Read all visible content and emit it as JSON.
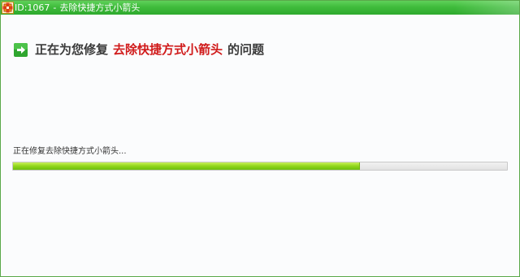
{
  "window": {
    "id_text": "ID:1067",
    "separator": "-",
    "title": "去除快捷方式小箭头"
  },
  "heading": {
    "prefix": "正在为您修复",
    "highlight": "去除快捷方式小箭头",
    "suffix": "的问题"
  },
  "status": {
    "text": "正在修复去除快捷方式小箭头..."
  },
  "progress": {
    "fraction": 0.7
  },
  "colors": {
    "titlebar": "#3fbc3c",
    "highlight": "#d01a1a",
    "progress_fill": "#8fd51a",
    "icon_green": "#2fa62f"
  },
  "icons": {
    "app": "app-logo-icon",
    "heading": "arrow-right-icon"
  }
}
